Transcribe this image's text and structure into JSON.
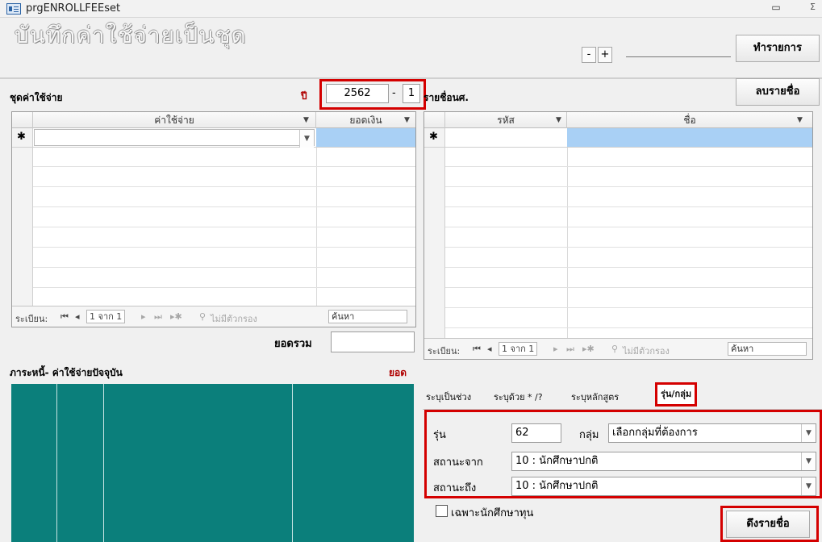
{
  "window": {
    "title": "prgENROLLFEEset",
    "min_glyph": "▭",
    "close_glyph": "Σ"
  },
  "header": {
    "form_title": "บันทึกค่าใช้จ่ายเป็นชุด",
    "nav_minus": "-",
    "nav_plus": "+",
    "do_button": "ทำรายการ"
  },
  "expense_set": {
    "label": "ชุดค่าใช้จ่าย",
    "year_label": "ปี",
    "year_value": "2562",
    "separator": "-",
    "term_value": "1",
    "columns": [
      "ค่าใช้จ่าย",
      "ยอดเงิน"
    ],
    "new_row_marker": "✱",
    "record_nav": {
      "label": "ระเบียน:",
      "first": "⏮",
      "prev": "◂",
      "position": "1 จาก 1",
      "next": "▸",
      "last": "⏭",
      "new": "▸✱",
      "filter": "ไม่มีตัวกรอง",
      "search": "ค้นหา"
    },
    "total_label": "ยอดรวม"
  },
  "student_list": {
    "label": "รายชื่อนศ.",
    "delete_button": "ลบรายชื่อ",
    "columns": [
      "รหัส",
      "ชื่อ"
    ],
    "new_row_marker": "✱",
    "record_nav": {
      "label": "ระเบียน:",
      "first": "⏮",
      "prev": "◂",
      "position": "1 จาก 1",
      "next": "▸",
      "last": "⏭",
      "new": "▸✱",
      "filter": "ไม่มีตัวกรอง",
      "search": "ค้นหา"
    }
  },
  "debt": {
    "label": "ภาระหนี้- ค่าใช้จ่ายปัจจุบัน",
    "right_label": "ยอด"
  },
  "tabs": [
    {
      "label": "ระบุเป็นช่วง"
    },
    {
      "label": "ระบุด้วย * /?"
    },
    {
      "label": "ระบุหลักสูตร"
    },
    {
      "label": "รุ่น/กลุ่ม"
    }
  ],
  "filter_panel": {
    "batch_label": "รุ่น",
    "batch_value": "62",
    "group_label": "กลุ่ม",
    "group_value": "เลือกกลุ่มที่ต้องการ",
    "status_from_label": "สถานะจาก",
    "status_from_value": "10 : นักศึกษาปกติ",
    "status_to_label": "สถานะถึง",
    "status_to_value": "10 : นักศึกษาปกติ",
    "scholarship_only_label": "เฉพาะนักศึกษาทุน",
    "pull_button": "ดึงรายชื่อ"
  },
  "colors": {
    "accent_red": "#d40000",
    "teal": "#0b7f7b",
    "highlight_blue": "#a9d0f5"
  }
}
